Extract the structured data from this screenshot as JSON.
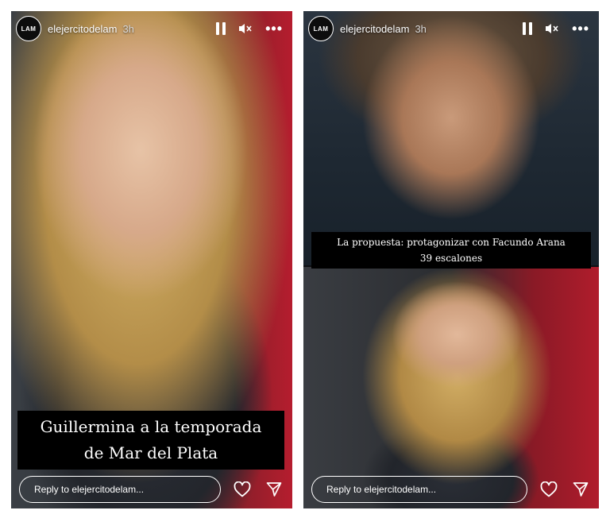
{
  "stories": [
    {
      "account": {
        "avatar_text": "LAM",
        "username": "elejercitodelam",
        "time": "3h"
      },
      "caption_lines": [
        "Guillermina a la temporada",
        "de Mar del Plata"
      ],
      "reply_placeholder": "Reply to elejercitodelam..."
    },
    {
      "account": {
        "avatar_text": "LAM",
        "username": "elejercitodelam",
        "time": "3h"
      },
      "caption_lines": [
        "La propuesta: protagonizar con Facundo Arana",
        "39 escalones"
      ],
      "reply_placeholder": "Reply to elejercitodelam..."
    }
  ],
  "icons": {
    "pause": "pause-icon",
    "mute": "speaker-muted-icon",
    "more": "more-options-icon",
    "like": "heart-icon",
    "share": "send-icon"
  },
  "more_glyph": "•••",
  "colors": {
    "caption_bg": "#000000",
    "text": "#ffffff",
    "frame": "#ffffff"
  }
}
